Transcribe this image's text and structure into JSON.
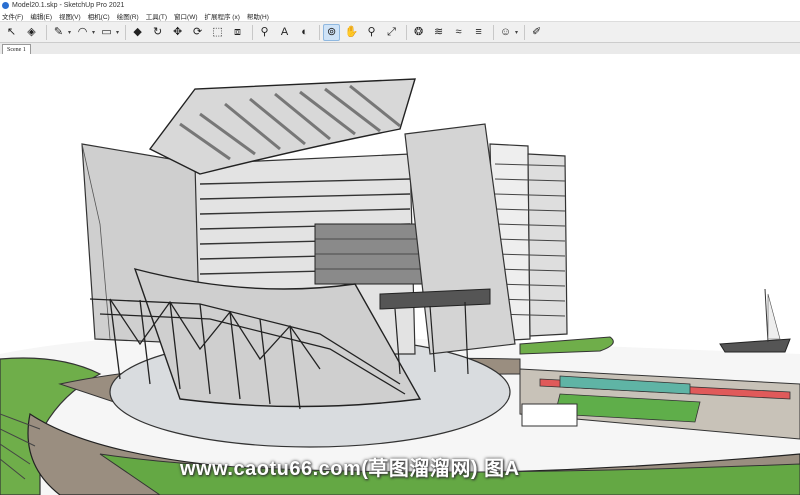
{
  "window": {
    "title": "Model20.1.skp - SketchUp Pro 2021"
  },
  "menu": [
    "文件(F)",
    "编辑(E)",
    "视图(V)",
    "相机(C)",
    "绘图(R)",
    "工具(T)",
    "窗口(W)",
    "扩展程序 (x)",
    "帮助(H)"
  ],
  "toolbar": {
    "tools": [
      {
        "name": "select-tool",
        "glyph": "↖"
      },
      {
        "name": "eraser-tool",
        "glyph": "◈"
      },
      {
        "name": "line-tool",
        "glyph": "✎",
        "dropdown": true
      },
      {
        "name": "arc-tool",
        "glyph": "◠",
        "dropdown": true
      },
      {
        "name": "rectangle-tool",
        "glyph": "▭",
        "dropdown": true
      },
      {
        "name": "push-pull-tool",
        "glyph": "◆"
      },
      {
        "name": "follow-me-tool",
        "glyph": "↻"
      },
      {
        "name": "move-tool",
        "glyph": "✥"
      },
      {
        "name": "rotate-tool",
        "glyph": "⟳"
      },
      {
        "name": "scale-tool",
        "glyph": "⬚"
      },
      {
        "name": "offset-tool",
        "glyph": "⧈"
      },
      {
        "name": "tape-measure-tool",
        "glyph": "⚲"
      },
      {
        "name": "text-tool",
        "glyph": "A"
      },
      {
        "name": "paint-bucket-tool",
        "glyph": "◐"
      },
      {
        "name": "orbit-tool",
        "glyph": "⊚"
      },
      {
        "name": "pan-tool",
        "glyph": "✋"
      },
      {
        "name": "zoom-tool",
        "glyph": "⚲"
      },
      {
        "name": "zoom-extents-tool",
        "glyph": "⤢"
      },
      {
        "name": "warehouse-tool",
        "glyph": "❂"
      },
      {
        "name": "extension-warehouse-tool",
        "glyph": "≋"
      },
      {
        "name": "layout-tool",
        "glyph": "≈"
      },
      {
        "name": "extension-manager-tool",
        "glyph": "≡"
      },
      {
        "name": "profile-tool",
        "glyph": "☺",
        "dropdown": true
      },
      {
        "name": "section-plane-tool",
        "glyph": "✐"
      }
    ]
  },
  "scenes": {
    "active": "Scene 1"
  },
  "watermark": "www.caotu66.com(草图溜溜网) 图A"
}
